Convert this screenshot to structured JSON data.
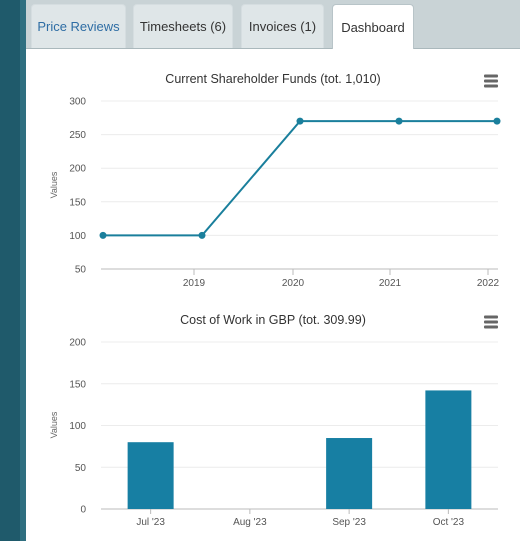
{
  "tabs": [
    {
      "label": "Price Reviews",
      "active": false
    },
    {
      "label": "Timesheets (6)",
      "active": false
    },
    {
      "label": "Invoices (1)",
      "active": false
    },
    {
      "label": "Dashboard",
      "active": true
    }
  ],
  "colors": {
    "accent": "#177fa3",
    "line": "#1a7f9c",
    "tab_link": "#2e6da4"
  },
  "charts": [
    {
      "chart_data": {
        "type": "line",
        "title": "Current Shareholder Funds (tot. 1,010)",
        "ylabel": "Values",
        "xlabel": "",
        "x_ticks": [
          "2019",
          "2020",
          "2021",
          "2022"
        ],
        "y_ticks": [
          "300",
          "250",
          "200",
          "150",
          "100",
          "50"
        ],
        "ylim": [
          50,
          300
        ],
        "series": [
          {
            "values": [
              100,
              100,
              270,
              270,
              270
            ]
          }
        ],
        "menu_icon": "hamburger-menu-icon",
        "grid": true
      }
    },
    {
      "chart_data": {
        "type": "bar",
        "title": "Cost of Work in GBP (tot. 309.99)",
        "ylabel": "Values",
        "xlabel": "",
        "categories": [
          "Jul '23",
          "Aug '23",
          "Sep '23",
          "Oct '23"
        ],
        "values": [
          80,
          0,
          85,
          142
        ],
        "y_ticks": [
          "200",
          "150",
          "100",
          "50",
          "0"
        ],
        "ylim": [
          0,
          200
        ],
        "menu_icon": "hamburger-menu-icon",
        "grid": true
      }
    }
  ]
}
